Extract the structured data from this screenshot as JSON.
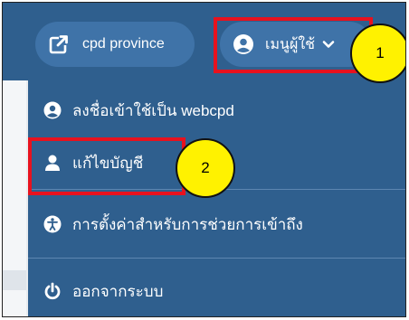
{
  "navbar": {
    "province_label": "cpd province",
    "menu_label": "เมนูผู้ใช้"
  },
  "dropdown": {
    "items": [
      {
        "label": "ลงชื่อเข้าใช้เป็น webcpd",
        "icon": "user-circle-icon"
      },
      {
        "label": "แก้ไขบัญชี",
        "icon": "user-icon"
      },
      {
        "label": "การตั้งค่าสำหรับการช่วยการเข้าถึง",
        "icon": "accessibility-icon"
      },
      {
        "label": "ออกจากระบบ",
        "icon": "power-icon"
      }
    ]
  },
  "callouts": [
    "1",
    "2"
  ],
  "colors": {
    "navbar": "#2f5f8e",
    "pill": "#3f73a8",
    "highlight": "#e8121e",
    "callout": "#fff200"
  }
}
